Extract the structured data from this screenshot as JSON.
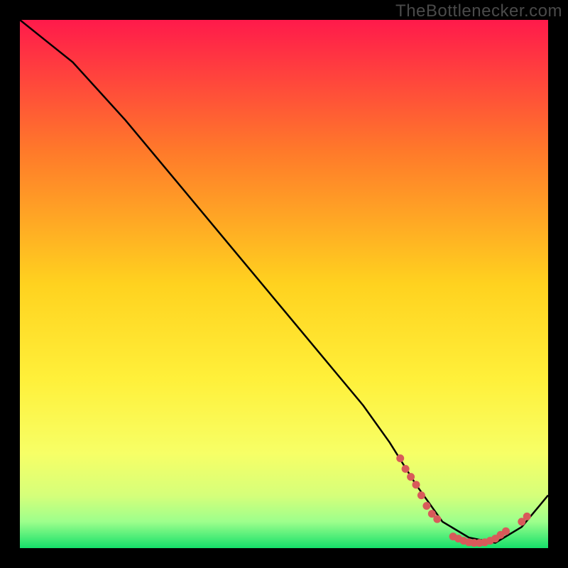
{
  "attribution": "TheBottlenecker.com",
  "colors": {
    "bg": "#000000",
    "grad_top": "#ff1a4b",
    "grad_mid1": "#ff7a2a",
    "grad_mid2": "#ffd21f",
    "grad_mid3": "#fff03a",
    "grad_low1": "#f7ff66",
    "grad_low2": "#d6ff7a",
    "grad_low3": "#9dff8c",
    "grad_bottom": "#15e06a",
    "curve": "#000000",
    "marker": "#d85a5a"
  },
  "chart_data": {
    "type": "line",
    "title": "",
    "xlabel": "",
    "ylabel": "",
    "xlim": [
      0,
      100
    ],
    "ylim": [
      0,
      100
    ],
    "grid": false,
    "legend": false,
    "series": [
      {
        "name": "bottleneck-curve",
        "x": [
          0,
          5,
          10,
          20,
          30,
          40,
          50,
          60,
          65,
          70,
          75,
          80,
          85,
          90,
          95,
          100
        ],
        "y": [
          100,
          96,
          92,
          81,
          69,
          57,
          45,
          33,
          27,
          20,
          12,
          5,
          2,
          1,
          4,
          10
        ]
      }
    ],
    "markers": [
      {
        "name": "highlight-segment-left",
        "type": "dotted-line",
        "points_x": [
          72,
          73,
          74,
          75,
          76,
          77,
          78,
          79
        ],
        "points_y": [
          17,
          15,
          13.5,
          12,
          10,
          8,
          6.5,
          5.5
        ]
      },
      {
        "name": "highlight-segment-bottom",
        "type": "dotted-line",
        "points_x": [
          82,
          83,
          84,
          85,
          86,
          87,
          88,
          89,
          90,
          91,
          92
        ],
        "points_y": [
          2.2,
          1.8,
          1.4,
          1.1,
          1.0,
          1.0,
          1.1,
          1.4,
          1.8,
          2.5,
          3.2
        ]
      },
      {
        "name": "highlight-segment-right",
        "type": "dotted-line",
        "points_x": [
          95,
          96
        ],
        "points_y": [
          5,
          6
        ]
      }
    ]
  }
}
